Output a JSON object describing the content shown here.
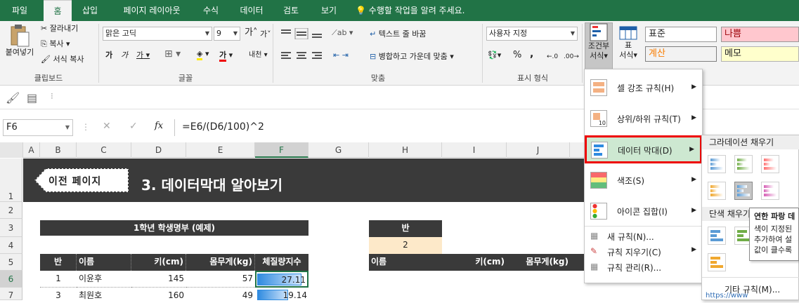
{
  "tabs": [
    "파일",
    "홈",
    "삽입",
    "페이지 레이아웃",
    "수식",
    "데이터",
    "검토",
    "보기"
  ],
  "tell_me": "수행할 작업을 알려 주세요.",
  "clipboard": {
    "paste": "붙여넣기",
    "cut": "잘라내기",
    "copy": "복사",
    "format_painter": "서식 복사",
    "group": "클립보드"
  },
  "font": {
    "name": "맑은 고딕",
    "size": "9",
    "grow": "가",
    "shrink": "가",
    "bold": "가",
    "italic": "가",
    "underline": "가",
    "color_a": "가",
    "phonetic": "내천",
    "group": "글꼴"
  },
  "align": {
    "wrap": "텍스트 줄 바꿈",
    "merge": "병합하고 가운데 맞춤",
    "group": "맞춤"
  },
  "number": {
    "format": "사용자 지정",
    "percent": "%",
    "comma": ",",
    "group": "표시 형식"
  },
  "styles": {
    "cond_line1": "조건부",
    "cond_line2": "서식",
    "table_line1": "표",
    "table_line2": "서식",
    "normal": "표준",
    "bad": "나쁨",
    "calc": "계산",
    "memo": "메모"
  },
  "namebox": "F6",
  "formula": "=E6/(D6/100)^2",
  "fx": "fx",
  "columns": [
    "A",
    "B",
    "C",
    "D",
    "E",
    "F",
    "G",
    "H",
    "I",
    "J"
  ],
  "rows": [
    "1",
    "2",
    "3",
    "4",
    "5",
    "6",
    "7"
  ],
  "banner": {
    "prev": "이전 페이지",
    "title": "3. 데이터막대 알아보기"
  },
  "table1": {
    "title": "1학년 학생명부 (예제)",
    "headers": [
      "반",
      "이름",
      "키(cm)",
      "몸무게(kg)",
      "체질량지수"
    ],
    "rows": [
      {
        "ban": "1",
        "name": "이윤후",
        "height": "145",
        "weight": "57",
        "bmi": "27.11",
        "bar": 0.92
      },
      {
        "ban": "3",
        "name": "최원호",
        "height": "160",
        "weight": "49",
        "bmi": "19.14",
        "bar": 0.65
      }
    ]
  },
  "table2": {
    "ban_label": "반",
    "ban_value": "2",
    "headers": [
      "이름",
      "키(cm)",
      "몸무게(kg)"
    ]
  },
  "cf_menu": {
    "items": [
      "셀 강조 규칙(H)",
      "상위/하위 규칙(T)",
      "데이터 막대(D)",
      "색조(S)",
      "아이콘 집합(I)"
    ],
    "top_icon_text": "10",
    "small_items": [
      "새 규칙(N)...",
      "규칙 지우기(C)",
      "규칙 관리(R)..."
    ]
  },
  "db_sub": {
    "gradient": "그라데이션 채우기",
    "solid": "단색 채우기",
    "more": "기타 규칙(M)..."
  },
  "tooltip": {
    "title": "연한 파랑 데",
    "lines": [
      "색이 지정된",
      "추가하여 설",
      "값이 클수록"
    ]
  },
  "url_fragment": "https://www.hoppedu.com"
}
